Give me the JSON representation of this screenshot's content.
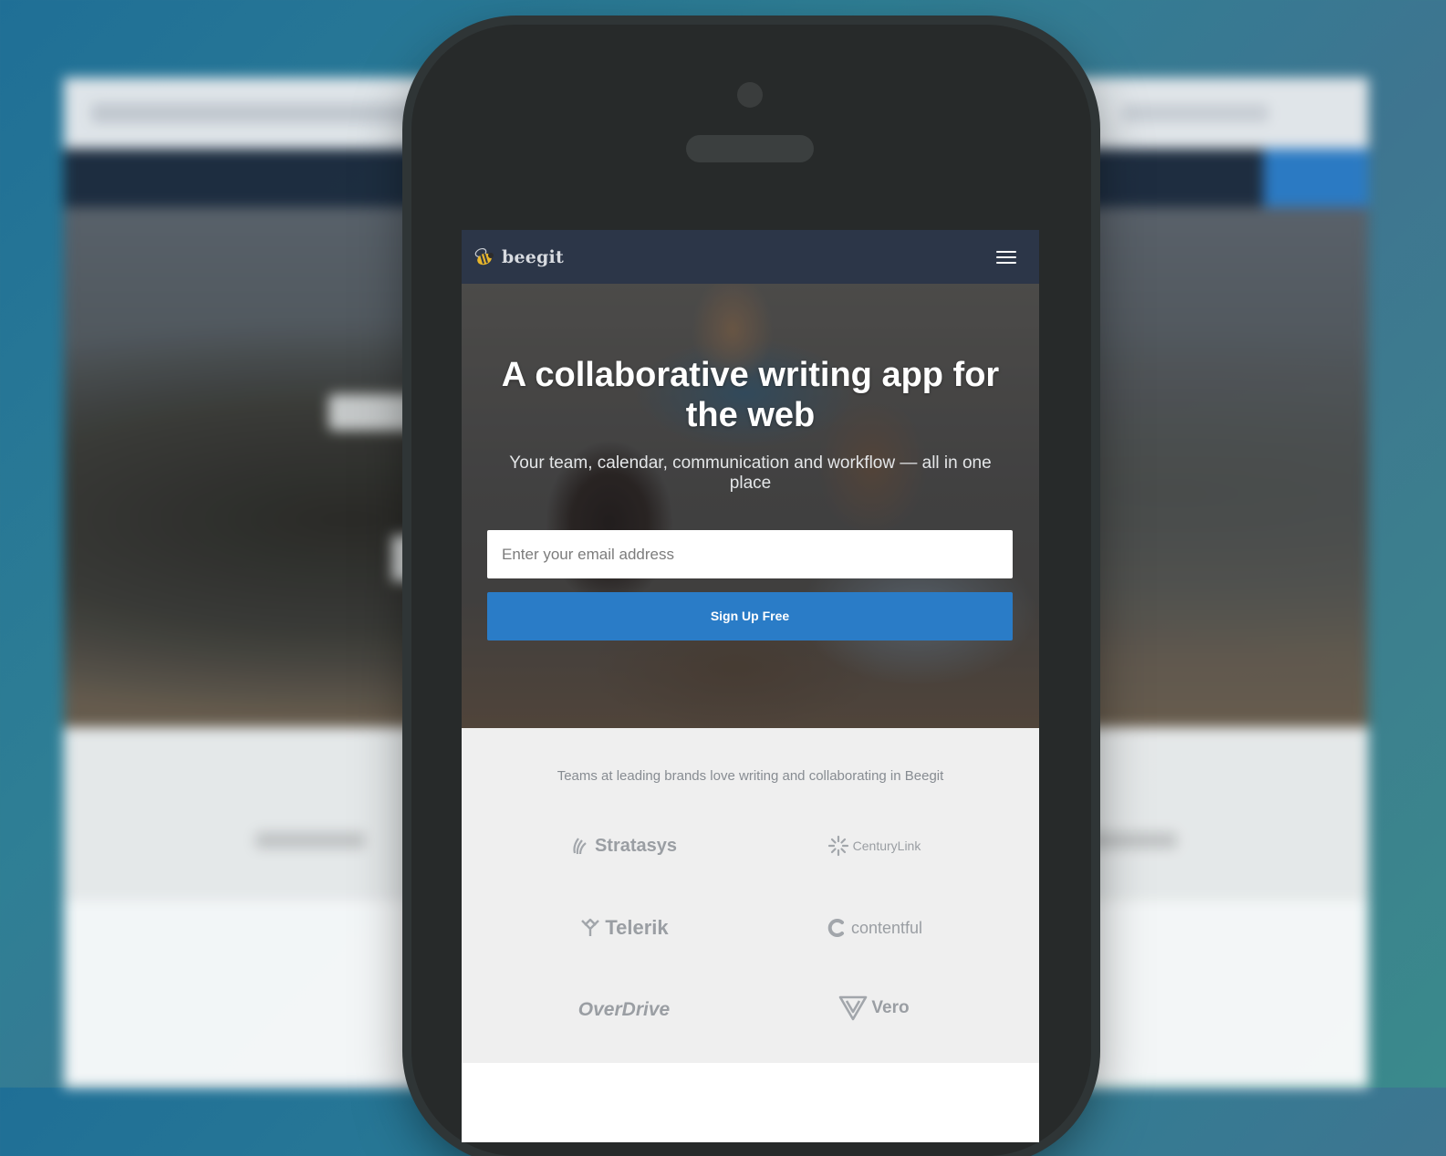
{
  "app": {
    "logo_text": "beegit",
    "menu_icon": "hamburger-menu-icon"
  },
  "hero": {
    "title": "A collaborative writing app for the web",
    "subtitle": "Your team, calendar, communication and workflow — all in one place",
    "email_placeholder": "Enter your email address",
    "signup_label": "Sign Up Free"
  },
  "brands": {
    "caption": "Teams at leading brands love writing and collaborating in Beegit",
    "items": [
      {
        "name": "Stratasys",
        "icon": "stratasys-logo-icon"
      },
      {
        "name": "CenturyLink",
        "icon": "centurylink-logo-icon"
      },
      {
        "name": "Telerik",
        "icon": "telerik-logo-icon"
      },
      {
        "name": "contentful",
        "icon": "contentful-logo-icon"
      },
      {
        "name": "OverDrive",
        "icon": "overdrive-logo-icon"
      },
      {
        "name": "Vero",
        "icon": "vero-logo-icon"
      }
    ]
  },
  "colors": {
    "nav_bg": "#2c3648",
    "accent": "#2a7cc7",
    "logos_bg": "#efefef",
    "phone_body": "#272a2a"
  }
}
